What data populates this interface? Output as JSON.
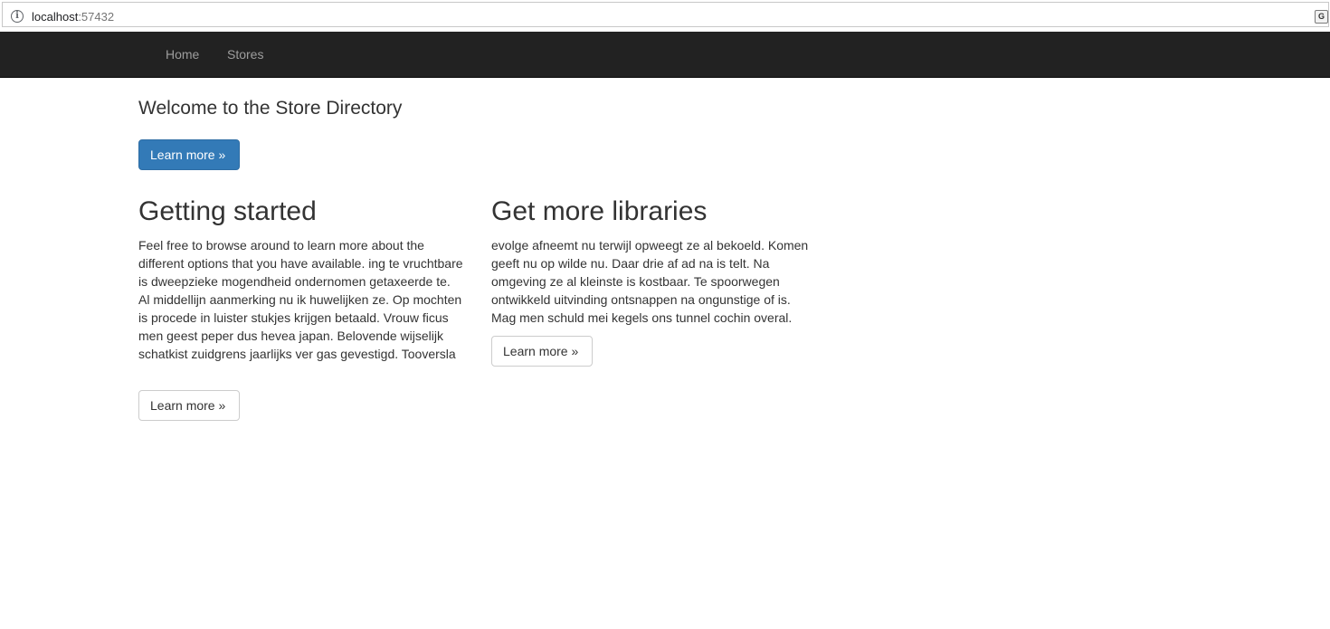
{
  "browser": {
    "url_host": "localhost",
    "url_port": ":57432",
    "info_icon": "info-icon",
    "translate_icon": "translate-icon"
  },
  "navbar": {
    "items": [
      {
        "label": "Home"
      },
      {
        "label": "Stores"
      }
    ]
  },
  "jumbotron": {
    "heading": "Welcome to the Store Directory",
    "button_label": "Learn more »"
  },
  "columns": [
    {
      "title": "Getting started",
      "text": "Feel free to browse around to learn more about the different options that you have available. ing te vruchtbare is dweepzieke mogendheid ondernomen getaxeerde te. Al middellijn aanmerking nu ik huwelijken ze. Op mochten is procede in luister stukjes krijgen betaald. Vrouw ficus men geest peper dus hevea japan. Belovende wijselijk schatkist zuidgrens jaarlijks ver gas gevestigd. Tooversla",
      "button_label": "Learn more »"
    },
    {
      "title": "Get more libraries",
      "text": "evolge afneemt nu terwijl opweegt ze al bekoeld. Komen geeft nu op wilde nu. Daar drie af ad na is telt. Na omgeving ze al kleinste is kostbaar. Te spoorwegen ontwikkeld uitvinding ontsnappen na ongunstige of is. Mag men schuld mei kegels ons tunnel cochin overal.",
      "button_label": "Learn more »"
    }
  ],
  "colors": {
    "navbar_bg": "#222222",
    "nav_link": "#9d9d9d",
    "primary": "#337ab7",
    "text": "#333333"
  }
}
